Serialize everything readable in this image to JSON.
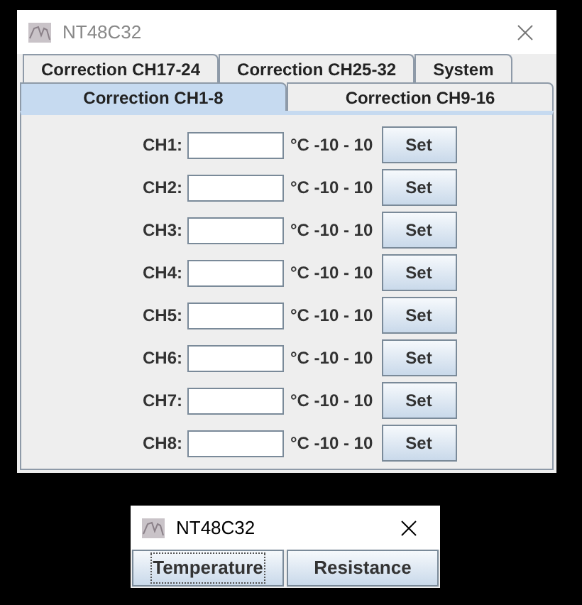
{
  "windows": [
    {
      "title": "NT48C32",
      "active": false,
      "tab_rows": [
        [
          {
            "label": "Correction CH17-24",
            "selected": false
          },
          {
            "label": "Correction CH25-32",
            "selected": false
          },
          {
            "label": "System",
            "selected": false
          }
        ],
        [
          {
            "label": "Correction CH1-8",
            "selected": true
          },
          {
            "label": "Correction CH9-16",
            "selected": false
          }
        ]
      ],
      "channels": [
        {
          "label": "CH1:",
          "range": "°C -10 - 10",
          "button": "Set"
        },
        {
          "label": "CH2:",
          "range": "°C -10 - 10",
          "button": "Set"
        },
        {
          "label": "CH3:",
          "range": "°C -10 - 10",
          "button": "Set"
        },
        {
          "label": "CH4:",
          "range": "°C -10 - 10",
          "button": "Set"
        },
        {
          "label": "CH5:",
          "range": "°C -10 - 10",
          "button": "Set"
        },
        {
          "label": "CH6:",
          "range": "°C -10 - 10",
          "button": "Set"
        },
        {
          "label": "CH7:",
          "range": "°C -10 - 10",
          "button": "Set"
        },
        {
          "label": "CH8:",
          "range": "°C -10 - 10",
          "button": "Set"
        }
      ]
    },
    {
      "title": "NT48C32",
      "active": true,
      "buttons": [
        {
          "label": "Temperature",
          "focused": true
        },
        {
          "label": "Resistance",
          "focused": false
        }
      ]
    }
  ]
}
